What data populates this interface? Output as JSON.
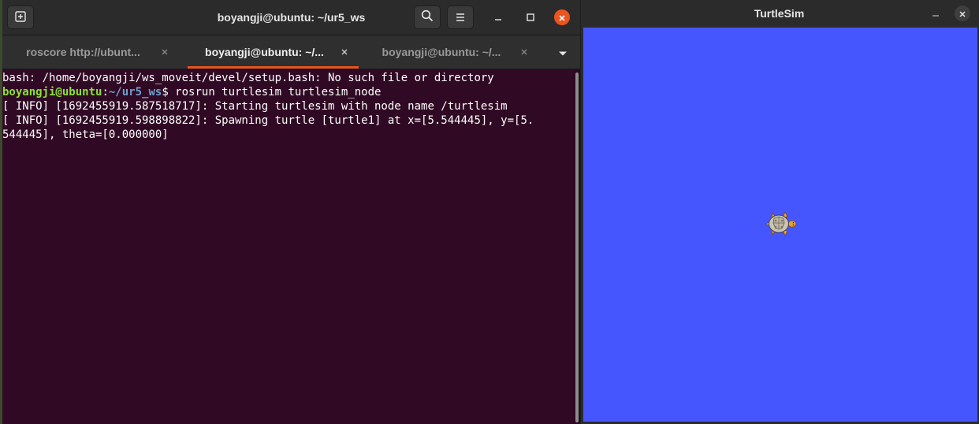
{
  "terminal": {
    "title": "boyangji@ubuntu: ~/ur5_ws",
    "icons": {
      "new_tab": "new-tab-icon",
      "search": "search-icon",
      "menu": "hamburger-menu-icon",
      "minimize": "minimize-icon",
      "maximize": "maximize-icon",
      "close": "close-icon"
    },
    "tabs": [
      {
        "label": "roscore http://ubunt...",
        "active": false
      },
      {
        "label": "boyangji@ubuntu: ~/...",
        "active": true
      },
      {
        "label": "boyangji@ubuntu: ~/...",
        "active": false
      }
    ],
    "lines": {
      "error": "bash: /home/boyangji/ws_moveit/devel/setup.bash: No such file or directory",
      "prompt_user": "boyangji@ubuntu",
      "prompt_colon": ":",
      "prompt_path": "~/ur5_ws",
      "prompt_symbol": "$ ",
      "command": "rosrun turtlesim turtlesim_node",
      "info1": "[ INFO] [1692455919.587518717]: Starting turtlesim with node name /turtlesim",
      "info2a": "[ INFO] [1692455919.598898822]: Spawning turtle [turtle1] at x=[5.544445], y=[5.",
      "info2b": "544445], theta=[0.000000]"
    },
    "colors": {
      "background": "#300a24",
      "accent": "#e95420",
      "prompt_user": "#8ae234",
      "prompt_path": "#729fcf"
    }
  },
  "turtlesim": {
    "title": "TurtleSim",
    "canvas_color": "#4556ff",
    "turtle": {
      "name": "turtle1",
      "x": 5.544445,
      "y": 5.544445,
      "theta": 0.0
    },
    "icons": {
      "minimize": "minimize-icon",
      "close": "close-icon"
    }
  }
}
